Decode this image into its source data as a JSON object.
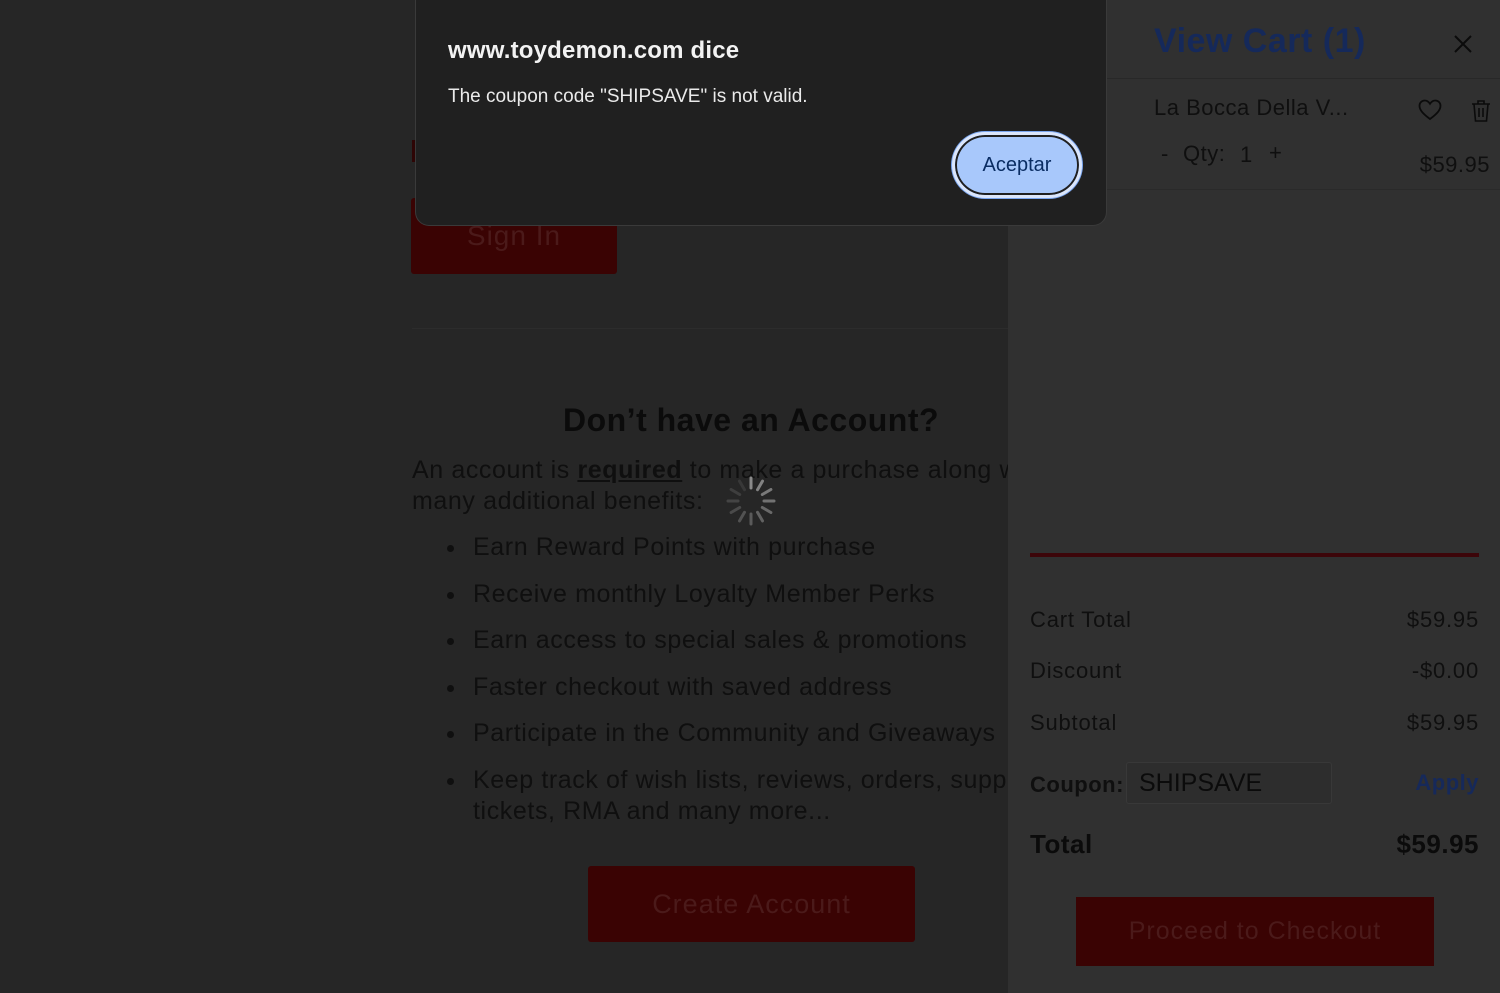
{
  "dialog": {
    "title": "www.toydemon.com dice",
    "message": "The coupon code \"SHIPSAVE\" is not valid.",
    "accept_label": "Aceptar"
  },
  "page": {
    "signin_label": "Sign In",
    "no_account_heading": "Don’t have an Account?",
    "intro_before": "An account is ",
    "intro_required": "required",
    "intro_after": " to make a purchase along w",
    "intro_line2": "many additional benefits:",
    "benefits": [
      "Earn Reward Points with purchase",
      "Receive monthly Loyalty Member Perks",
      "Earn access to special sales & promotions",
      "Faster checkout with saved address",
      "Participate in the Community and Giveaways",
      "Keep track of wish lists, reviews, orders, suppo tickets, RMA and many more..."
    ],
    "create_account_label": "Create Account"
  },
  "cart": {
    "title": "View Cart (1)",
    "close_icon": "close-icon",
    "item": {
      "name": "La Bocca Della V...",
      "qty_minus": "-",
      "qty_label": "Qty:",
      "qty_value": "1",
      "qty_plus": "+",
      "price": "$59.95",
      "wishlist_icon": "heart-icon",
      "delete_icon": "trash-icon"
    },
    "summary": {
      "cart_total_label": "Cart Total",
      "cart_total_value": "$59.95",
      "discount_label": "Discount",
      "discount_value": "-$0.00",
      "subtotal_label": "Subtotal",
      "subtotal_value": "$59.95"
    },
    "coupon": {
      "label": "Coupon:",
      "value": "SHIPSAVE",
      "apply_label": "Apply"
    },
    "total_label": "Total",
    "total_value": "$59.95",
    "checkout_label": "Proceed to Checkout"
  },
  "colors": {
    "accent_blue": "#a8c8fb",
    "brand_red": "#3a0303",
    "drawer_title": "#15295a"
  }
}
